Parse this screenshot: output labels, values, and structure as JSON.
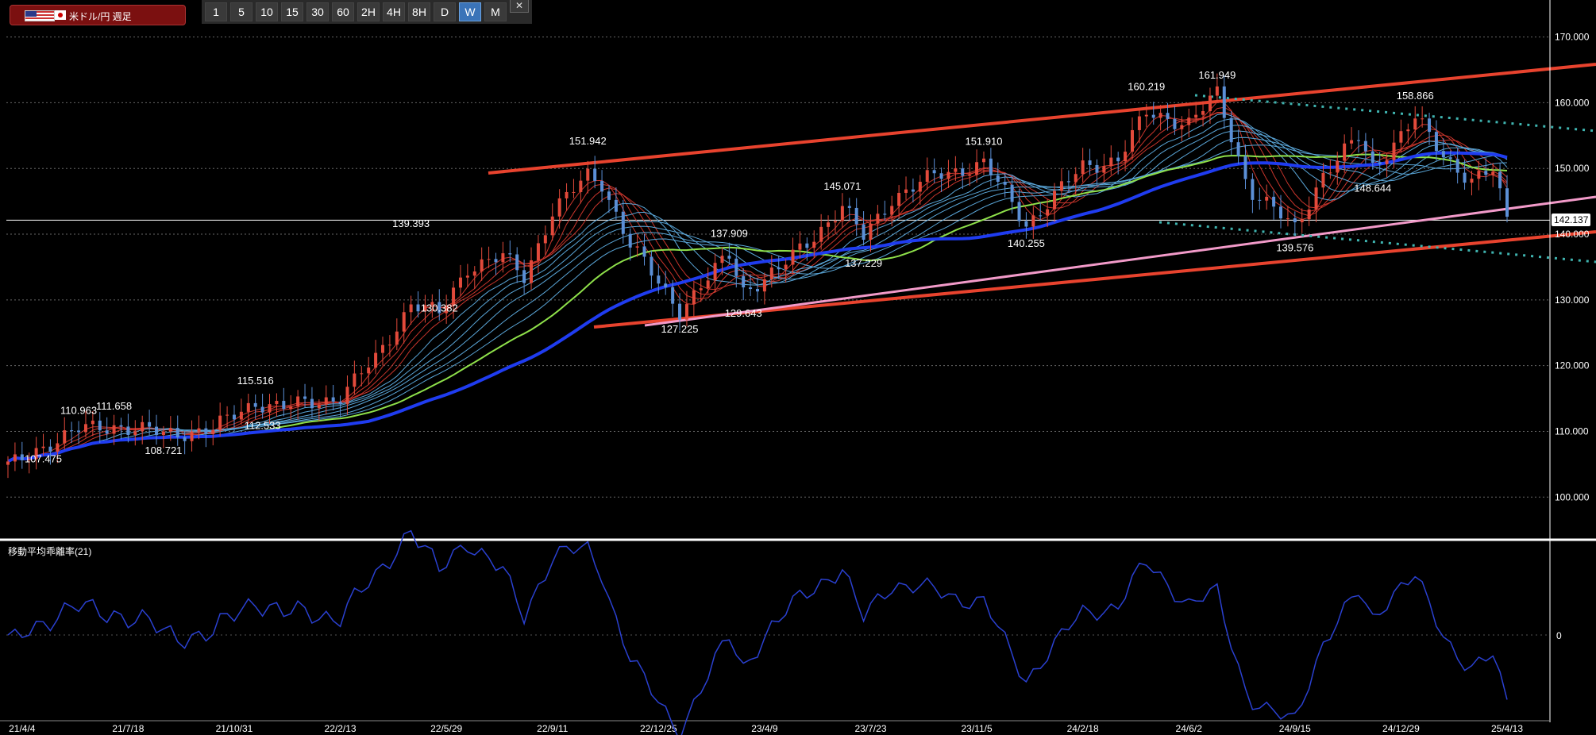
{
  "header": {
    "pair_label": "米ドル/円 週足",
    "timeframes": [
      "1",
      "5",
      "10",
      "15",
      "30",
      "60",
      "2H",
      "4H",
      "8H",
      "D",
      "W",
      "M"
    ],
    "active_timeframe": "W",
    "close_symbol": "✕"
  },
  "colors": {
    "background": "#000000",
    "bull_candle": "#e24a3b",
    "bear_candle": "#5b8fd6",
    "trend_red": "#e8432e",
    "trend_pink": "#f29ac9",
    "trend_teal_dotted": "#3fb4b0",
    "ma_blue": "#1f3cf0",
    "ma_green": "#8ee04a",
    "deviation_line": "#2a40d0"
  },
  "chart_data": [
    {
      "type": "candlestick",
      "title": "米ドル/円 週足",
      "x_tick_labels": [
        "21/4/4",
        "21/7/18",
        "21/10/31",
        "22/2/13",
        "22/5/29",
        "22/9/11",
        "22/12/25",
        "23/4/9",
        "23/7/23",
        "23/11/5",
        "24/2/18",
        "24/6/2",
        "24/9/15",
        "24/12/29",
        "25/4/13"
      ],
      "y_tick_labels": [
        "100.000",
        "110.000",
        "120.000",
        "130.000",
        "140.000",
        "150.000",
        "160.000",
        "170.000"
      ],
      "ylim": [
        94,
        172
      ],
      "current_price": "142.137",
      "peak_labels": [
        {
          "x": "21/5/30",
          "value": "110.963",
          "pos": "above"
        },
        {
          "x": "21/4/25",
          "value": "107.475",
          "pos": "below"
        },
        {
          "x": "21/7/4",
          "value": "111.658",
          "pos": "above"
        },
        {
          "x": "21/8/22",
          "value": "108.721",
          "pos": "below"
        },
        {
          "x": "21/11/21",
          "value": "115.516",
          "pos": "above"
        },
        {
          "x": "21/11/28",
          "value": "112.533",
          "pos": "below"
        },
        {
          "x": "22/4/24",
          "value": "139.393",
          "pos": "above"
        },
        {
          "x": "22/5/22",
          "value": "130.382",
          "pos": "below"
        },
        {
          "x": "22/10/16",
          "value": "151.942",
          "pos": "above"
        },
        {
          "x": "23/1/15",
          "value": "127.225",
          "pos": "below"
        },
        {
          "x": "23/3/5",
          "value": "137.909",
          "pos": "above"
        },
        {
          "x": "23/3/19",
          "value": "129.643",
          "pos": "below"
        },
        {
          "x": "23/6/25",
          "value": "145.071",
          "pos": "above"
        },
        {
          "x": "23/7/16",
          "value": "137.229",
          "pos": "below"
        },
        {
          "x": "23/11/12",
          "value": "151.910",
          "pos": "above"
        },
        {
          "x": "23/12/24",
          "value": "140.255",
          "pos": "below"
        },
        {
          "x": "24/4/21",
          "value": "160.219",
          "pos": "above"
        },
        {
          "x": "24/6/30",
          "value": "161.949",
          "pos": "above"
        },
        {
          "x": "24/9/15",
          "value": "139.576",
          "pos": "below"
        },
        {
          "x": "25/1/12",
          "value": "158.866",
          "pos": "above"
        },
        {
          "x": "24/12/1",
          "value": "148.644",
          "pos": "below"
        }
      ]
    },
    {
      "type": "line",
      "title": "移動平均乖離率(21)",
      "y_tick_labels": [
        "0"
      ],
      "x_tick_labels": [
        "21/4/4",
        "21/7/18",
        "21/10/31",
        "22/2/13",
        "22/5/29",
        "22/9/11",
        "22/12/25",
        "23/4/9",
        "23/7/23",
        "23/11/5",
        "24/2/18",
        "24/6/2",
        "24/9/15",
        "24/12/29",
        "25/4/13"
      ]
    }
  ]
}
